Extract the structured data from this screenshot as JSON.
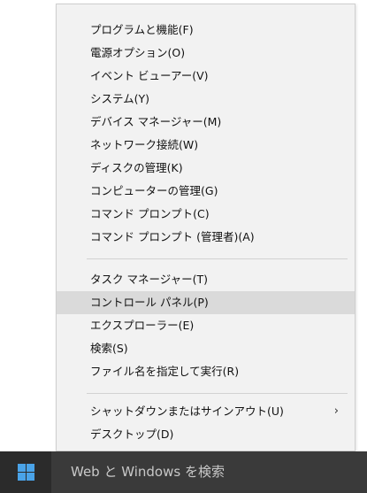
{
  "context_menu": {
    "groups": [
      {
        "items": [
          {
            "label": "プログラムと機能(F)"
          },
          {
            "label": "電源オプション(O)"
          },
          {
            "label": "イベント ビューアー(V)"
          },
          {
            "label": "システム(Y)"
          },
          {
            "label": "デバイス マネージャー(M)"
          },
          {
            "label": "ネットワーク接続(W)"
          },
          {
            "label": "ディスクの管理(K)"
          },
          {
            "label": "コンピューターの管理(G)"
          },
          {
            "label": "コマンド プロンプト(C)"
          },
          {
            "label": "コマンド プロンプト (管理者)(A)"
          }
        ]
      },
      {
        "items": [
          {
            "label": "タスク マネージャー(T)"
          },
          {
            "label": "コントロール パネル(P)",
            "highlighted": true
          },
          {
            "label": "エクスプローラー(E)"
          },
          {
            "label": "検索(S)"
          },
          {
            "label": "ファイル名を指定して実行(R)"
          }
        ]
      },
      {
        "items": [
          {
            "label": "シャットダウンまたはサインアウト(U)",
            "submenu_arrow": "›"
          },
          {
            "label": "デスクトップ(D)"
          }
        ]
      }
    ]
  },
  "taskbar": {
    "start_icon": "windows-logo-icon",
    "search_placeholder": "Web と Windows を検索",
    "colors": {
      "logo": "#4aa3e8",
      "taskbar": "#1a1a1a",
      "search_box": "#3a3a3a"
    }
  }
}
